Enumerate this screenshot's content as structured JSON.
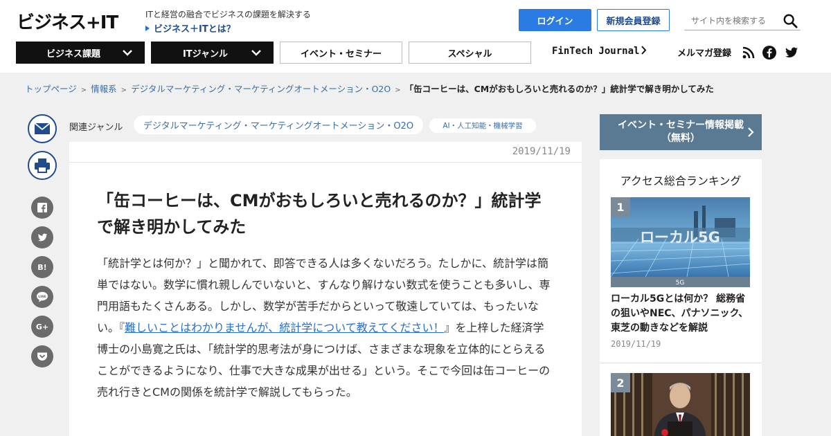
{
  "header": {
    "logo": "ビジネス+IT",
    "tagline": "ITと経営の融合でビジネスの課題を解決する",
    "whatis": "ビジネス＋ITとは？",
    "login": "ログイン",
    "register": "新規会員登録",
    "search_placeholder": "サイト内を検索する"
  },
  "nav": {
    "business": "ビジネス課題",
    "it_genre": "ITジャンル",
    "event": "イベント・セミナー",
    "special": "スペシャル",
    "fintech": "FinTech Journal",
    "mailmag": "メルマガ登録"
  },
  "breadcrumb": {
    "items": [
      "トップページ",
      "情報系",
      "デジタルマーケティング・マーケティングオートメーション・O2O"
    ],
    "current": "「缶コーヒーは、CMがおもしろいと売れるのか？」統計学で解き明かしてみた"
  },
  "genre": {
    "label": "関連ジャンル",
    "tags": [
      "デジタルマーケティング・マーケティングオートメーション・O2O",
      "AI・人工知能・機械学習"
    ]
  },
  "share": {
    "hatena": "B!",
    "line": "LINE",
    "gplus": "G+"
  },
  "article": {
    "date": "2019/11/19",
    "title": "「缶コーヒーは、CMがおもしろいと売れるのか？」統計学で解き明かしてみた",
    "lead_before": "「統計学とは何か？」と聞かれて、即答できる人は多くないだろう。たしかに、統計学は簡単ではない。数学に慣れ親しんでいないと、すんなり解けない数式を使うことも多いし、専門用語もたくさんある。しかし、数学が苦手だからといって敬遠していては、もったいない。『",
    "lead_link": "難しいことはわかりませんが、統計学について教えてください！",
    "lead_after": "』を上梓した経済学博士の小島寛之氏は、「統計学的思考法が身につけば、さまざまな現象を立体的にとらえることができるようになり、仕事で大きな成果が出せる」という。そこで今回は缶コーヒーの売れ行きとCMの関係を統計学で解説してもらった。"
  },
  "sidebar": {
    "event_line1": "イベント・セミナー情報掲載",
    "event_line2": "（無料）",
    "ranking_title": "アクセス総合ランキング",
    "rank1": {
      "num": "1",
      "image_text": "ローカル5G",
      "image_caption": "5G",
      "title": "ローカル5Gとは何か？ 総務省の狙いやNEC、パナソニック、東芝の動きなどを解説",
      "date": "2019/11/19"
    },
    "rank2": {
      "num": "2"
    }
  },
  "colors": {
    "brand_blue": "#2a7be4",
    "link_blue": "#3a6ea5",
    "dark_nav": "#111111",
    "banner": "#5a7a93"
  }
}
